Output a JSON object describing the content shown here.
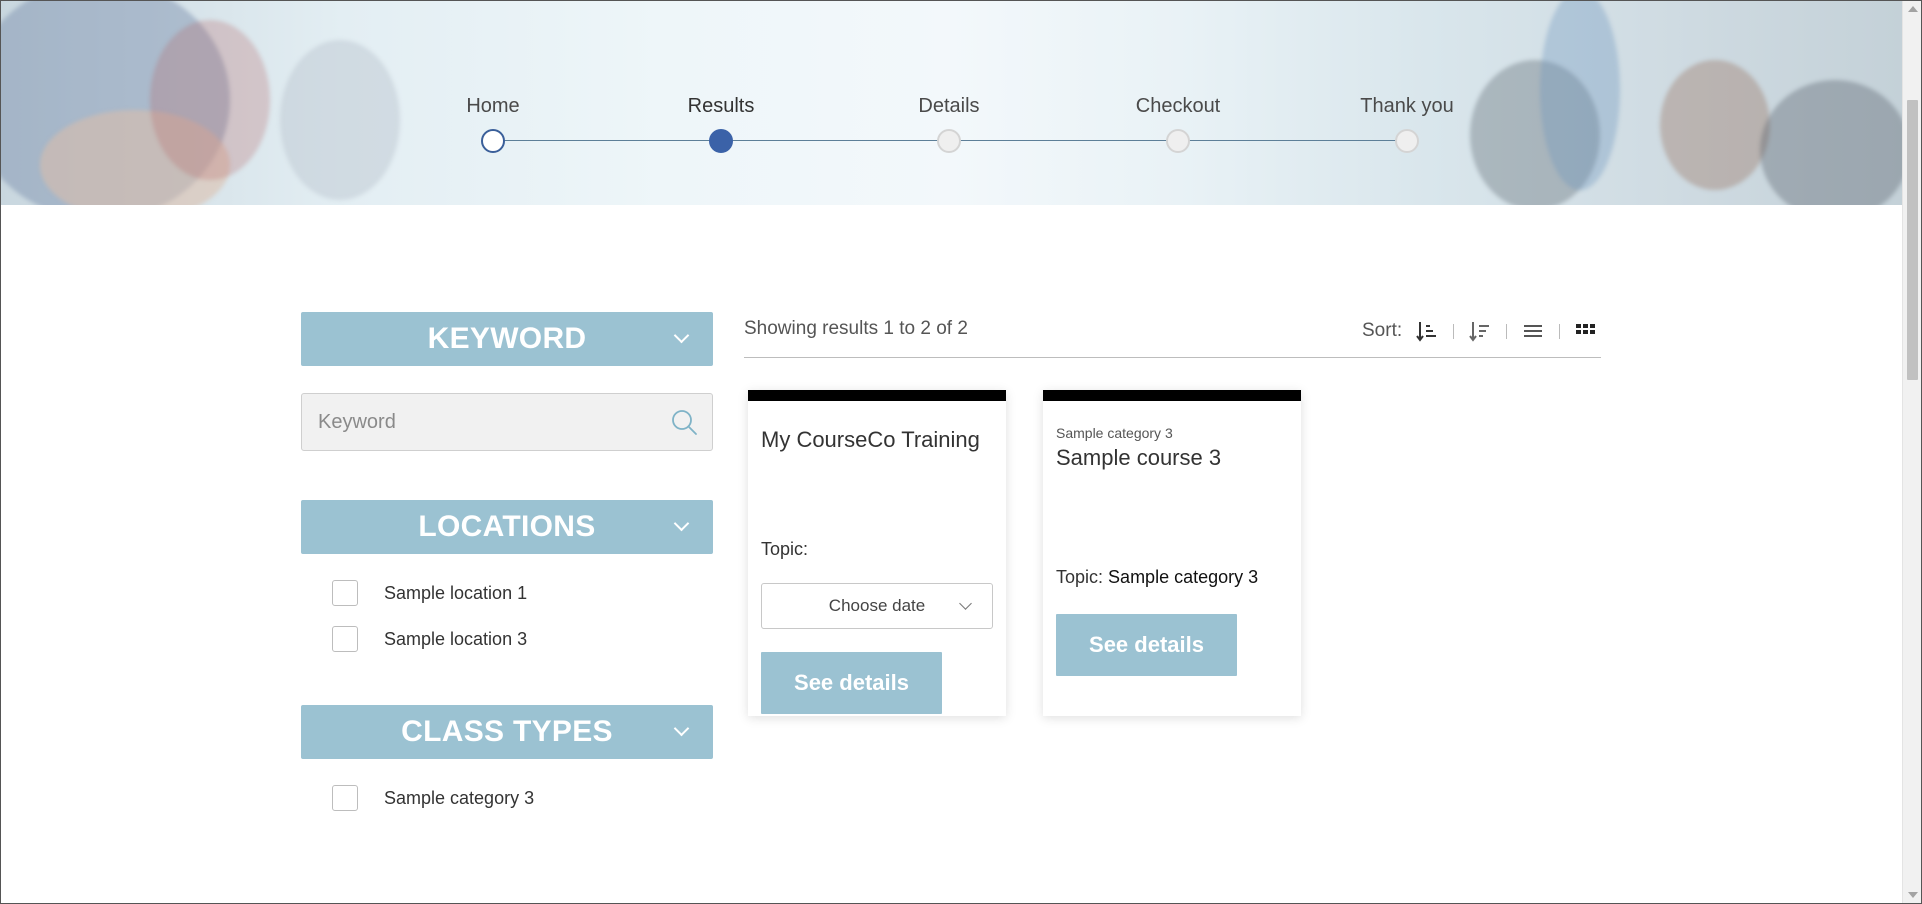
{
  "stepper": {
    "steps": [
      {
        "label": "Home",
        "state": "done"
      },
      {
        "label": "Results",
        "state": "active"
      },
      {
        "label": "Details",
        "state": "pending"
      },
      {
        "label": "Checkout",
        "state": "pending"
      },
      {
        "label": "Thank you",
        "state": "pending"
      }
    ]
  },
  "sidebar": {
    "keyword": {
      "heading": "KEYWORD",
      "placeholder": "Keyword",
      "value": ""
    },
    "locations": {
      "heading": "LOCATIONS",
      "items": [
        {
          "label": "Sample location 1",
          "checked": false
        },
        {
          "label": "Sample location 3",
          "checked": false
        }
      ]
    },
    "class_types": {
      "heading": "CLASS TYPES",
      "items": [
        {
          "label": "Sample category 3",
          "checked": false
        }
      ]
    }
  },
  "results": {
    "summary": "Showing results 1 to 2 of 2",
    "sort_label": "Sort:",
    "cards": [
      {
        "category": "",
        "title": "My CourseCo Training",
        "topic_label": "Topic:",
        "topic_value": "",
        "date_select": "Choose date",
        "button": "See details"
      },
      {
        "category": "Sample category 3",
        "title": "Sample course 3",
        "topic_label": "Topic:",
        "topic_value": "Sample category 3",
        "button": "See details"
      }
    ]
  },
  "colors": {
    "accent": "#9bc2d2",
    "stepper_active": "#3b62a8",
    "card_top_border": "#000000"
  },
  "icons": [
    "search-icon",
    "sort-ascending-icon",
    "sort-descending-icon",
    "list-view-icon",
    "grid-view-icon",
    "chevron-down-icon"
  ]
}
